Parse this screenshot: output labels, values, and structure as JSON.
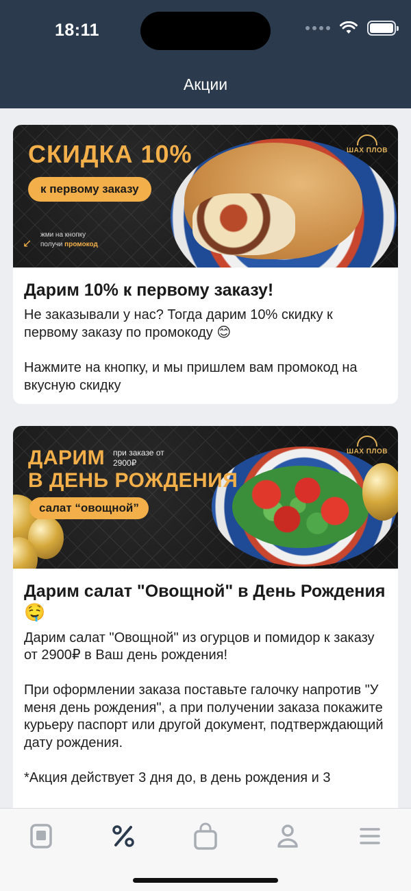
{
  "status_bar": {
    "time": "18:11"
  },
  "header": {
    "title": "Акции"
  },
  "promos": [
    {
      "banner": {
        "headline": "СКИДКА 10%",
        "pill": "к первому заказу",
        "hint_line1": "жми на кнопку",
        "hint_line2_prefix": "получи ",
        "hint_line2_accent": "промокод",
        "logo": "ШАХ ПЛОВ"
      },
      "title": "Дарим 10% к первому заказу!",
      "text": "Не заказывали у нас? Тогда дарим 10% скидку к первому заказу по промокоду 😊\n\nНажмите на кнопку, и мы пришлем вам промокод на вкусную скидку"
    },
    {
      "banner": {
        "headline_line1": "ДАРИМ",
        "headline_line2": "В ДЕНЬ РОЖДЕНИЯ",
        "note": "при заказе от 2900₽",
        "pill": "салат “овощной”",
        "logo": "ШАХ ПЛОВ"
      },
      "title": "Дарим салат \"Овощной\" в День Рождения 🤤",
      "text": "Дарим салат \"Овощной\" из огурцов и помидор к заказу от 2900₽ в Ваш день рождения!\n\nПри оформлении заказа поставьте галочку напротив \"У меня день рождения\", а при получении заказа покажите курьеру паспорт или другой документ, подтверждающий дату рождения.\n\n*Акция действует 3 дня до, в день рождения и 3"
    }
  ],
  "tabbar": {
    "tabs": [
      {
        "icon": "menu-book-icon",
        "active": false
      },
      {
        "icon": "percent-icon",
        "active": true
      },
      {
        "icon": "shopping-bag-icon",
        "active": false
      },
      {
        "icon": "profile-icon",
        "active": false
      },
      {
        "icon": "hamburger-menu-icon",
        "active": false
      }
    ]
  },
  "colors": {
    "header": "#2b3a4d",
    "accent": "#f3b04a",
    "tab_active": "#2b3a4d",
    "tab_inactive": "#a9adb4"
  }
}
